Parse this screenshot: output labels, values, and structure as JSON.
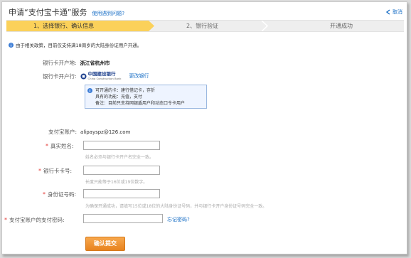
{
  "header": {
    "title": "申请“支付宝卡通”服务",
    "help_link": "使用遇到问题?",
    "cancel_label": "取消"
  },
  "steps": [
    {
      "label": "1、选择银行、确认信息",
      "active": true
    },
    {
      "label": "2、银行验证",
      "active": false
    },
    {
      "label": "开通成功",
      "active": false
    }
  ],
  "notice": "由于相关政策，目前仅支持满18周岁的大陆身份证用户开通。",
  "form": {
    "bank_location_label": "银行卡开户地:",
    "bank_location_value": "浙江省杭州市",
    "bank_label": "银行卡开户行:",
    "bank_logo_cn": "中国建设银行",
    "bank_logo_en": "China Construction Bank",
    "change_bank": "更改银行",
    "tip_lines": [
      "可开通的卡：建行借记卡，存折",
      "具有的功能：充值，支付",
      "备注：目前只支持网银盾用户和动态口令卡用户"
    ],
    "account_label": "支付宝账户:",
    "account_value": "alipayspz@126.com",
    "real_name_label": "真实姓名:",
    "real_name_value": "",
    "real_name_hint": "姓名必须与银行卡开户名完全一致。",
    "card_label": "银行卡卡号:",
    "card_value": "",
    "card_hint": "长度只能等于16位或19位数字。",
    "id_label": "身份证号码:",
    "id_value": "",
    "id_hint": "为确保开通成功，请填写15位或18位的大陆身份证号码，并与银行卡开户身份证号码完全一致。",
    "pay_pwd_label": "支付宝账户的支付密码:",
    "pay_pwd_value": "",
    "forgot_password": "忘记密码?",
    "submit_label": "确认提交"
  },
  "colors": {
    "accent": "#fbd15a",
    "link": "#1a6fc6",
    "required": "#e53935",
    "button": "#e8831e"
  }
}
